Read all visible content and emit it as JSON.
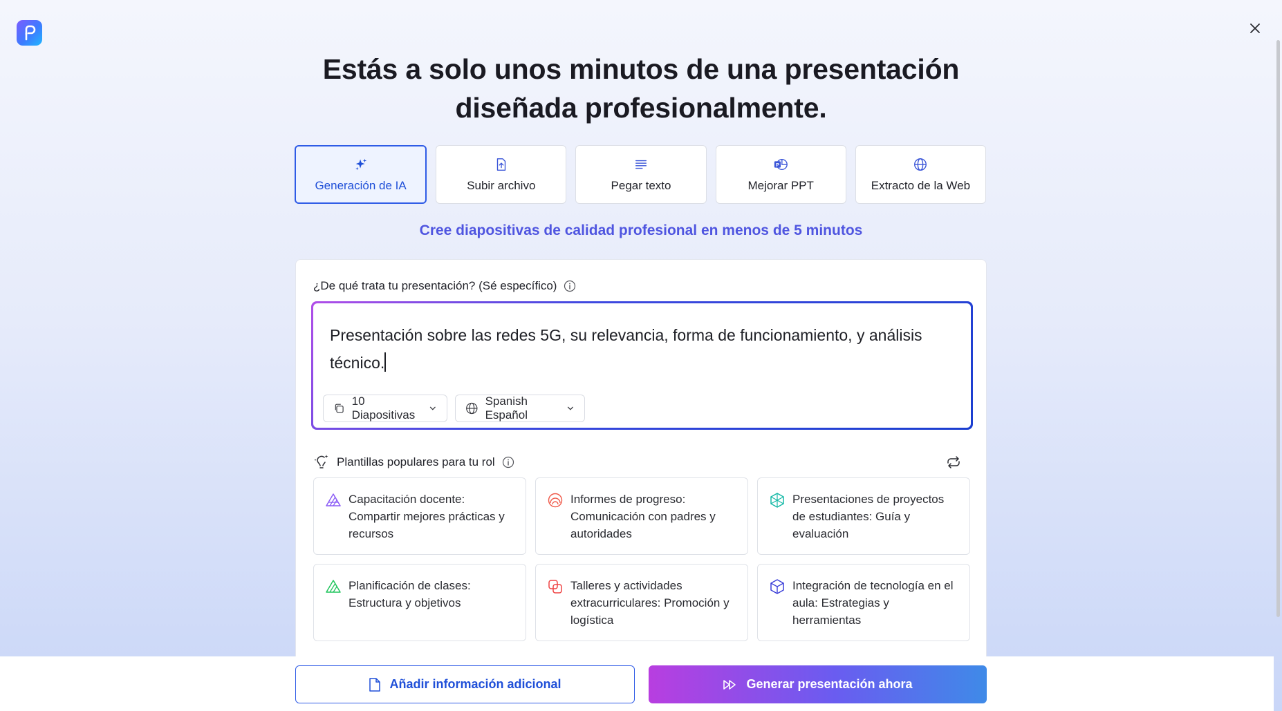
{
  "header": {
    "title_line1": "Estás a solo unos minutos de una presentación",
    "title_line2": "diseñada profesionalmente."
  },
  "tabs": [
    {
      "label": "Generación de IA",
      "icon": "sparkle-icon",
      "active": true
    },
    {
      "label": "Subir archivo",
      "icon": "file-upload-icon",
      "active": false
    },
    {
      "label": "Pegar texto",
      "icon": "text-lines-icon",
      "active": false
    },
    {
      "label": "Mejorar PPT",
      "icon": "powerpoint-icon",
      "active": false
    },
    {
      "label": "Extracto de la Web",
      "icon": "globe-icon",
      "active": false
    }
  ],
  "subtitle": "Cree diapositivas de calidad profesional en menos de 5 minutos",
  "form": {
    "question_label": "¿De qué trata tu presentación? (Sé específico)",
    "prompt_value": "Presentación sobre las redes 5G, su relevancia, forma de funcionamiento, y análisis técnico.",
    "slides_select": "10 Diapositivas",
    "language_select": "Spanish Español"
  },
  "templates": {
    "heading": "Plantillas populares para tu rol",
    "items": [
      {
        "label": "Capacitación docente: Compartir mejores prácticas y recursos",
        "icon": "triangles-icon",
        "color": "#8b5cf6"
      },
      {
        "label": "Informes de progreso: Comunicación con padres y autoridades",
        "icon": "rings-icon",
        "color": "#ef5a4a"
      },
      {
        "label": "Presentaciones de proyectos de estudiantes: Guía y evaluación",
        "icon": "hexagon-icon",
        "color": "#14b8a6"
      },
      {
        "label": "Planificación de clases: Estructura y objetivos",
        "icon": "triangles-icon",
        "color": "#22c55e"
      },
      {
        "label": "Talleres y actividades extracurriculares: Promoción y logística",
        "icon": "overlap-squares-icon",
        "color": "#ef4444"
      },
      {
        "label": "Integración de tecnología en el aula: Estrategias y herramientas",
        "icon": "cube-icon",
        "color": "#3b3fd8"
      }
    ]
  },
  "footer": {
    "add_info_label": "Añadir información adicional",
    "generate_label": "Generar presentación ahora"
  },
  "colors": {
    "accent": "#2e5be6",
    "subtitle": "#4f55e0",
    "gradient_start": "#b83ee0",
    "gradient_end": "#3f8ae8"
  }
}
